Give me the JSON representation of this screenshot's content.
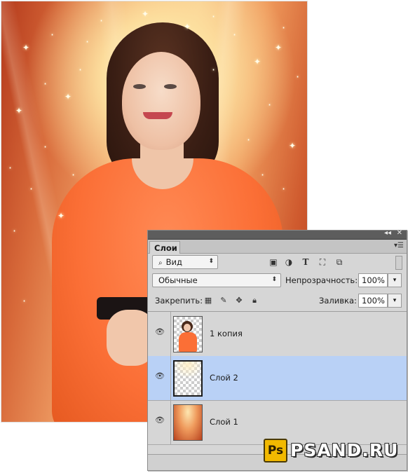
{
  "panel": {
    "tab_label": "Слои",
    "collapse_glyph": "◂◂",
    "close_glyph": "✕",
    "menu_glyph": "▾☰",
    "filter": {
      "value": "Вид",
      "icon": "search-icon"
    },
    "filter_icons": [
      "image-filter-icon",
      "adjustment-filter-icon",
      "type-filter-icon",
      "shape-filter-icon",
      "smart-object-filter-icon"
    ],
    "blend_mode": "Обычные",
    "opacity_label": "Непрозрачность:",
    "opacity_value": "100%",
    "lock_label": "Закрепить:",
    "lock_icons": [
      "lock-transparency-icon",
      "lock-image-icon",
      "lock-position-icon",
      "lock-all-icon"
    ],
    "fill_label": "Заливка:",
    "fill_value": "100%",
    "layers": [
      {
        "name": "1 копия",
        "selected": false,
        "visible": true
      },
      {
        "name": "Слой 2",
        "selected": true,
        "visible": true
      },
      {
        "name": "Слой 1",
        "selected": false,
        "visible": true
      }
    ]
  },
  "watermark": {
    "logo": "Ps",
    "text": "PSAND.RU"
  },
  "colors": {
    "selection": "#b9d1f6",
    "panel_bg": "#d6d6d6",
    "dress": "#fb6f36",
    "logo_yellow": "#f2b900"
  }
}
